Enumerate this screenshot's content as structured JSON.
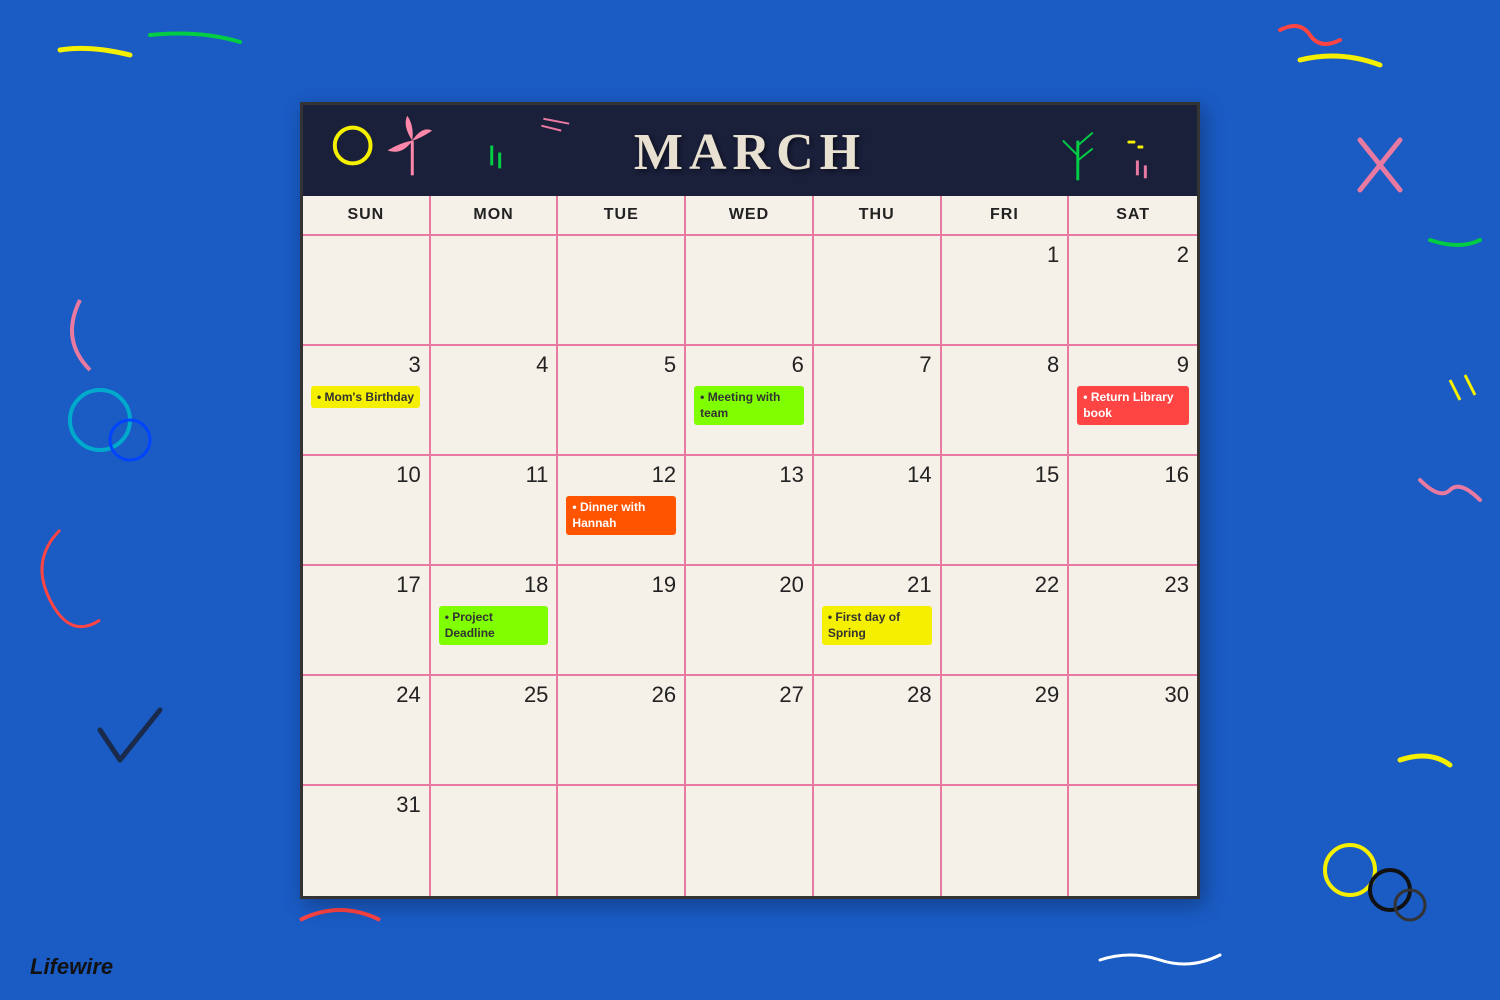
{
  "calendar": {
    "month": "MARCH",
    "day_names": [
      "SUN",
      "MON",
      "TUE",
      "WED",
      "THU",
      "FRI",
      "SAT"
    ],
    "cells": [
      {
        "day": "",
        "events": []
      },
      {
        "day": "",
        "events": []
      },
      {
        "day": "",
        "events": []
      },
      {
        "day": "",
        "events": []
      },
      {
        "day": "",
        "events": []
      },
      {
        "day": "1",
        "events": []
      },
      {
        "day": "2",
        "events": []
      },
      {
        "day": "3",
        "events": [
          {
            "label": "Mom's Birthday",
            "color": "event-yellow"
          }
        ]
      },
      {
        "day": "4",
        "events": []
      },
      {
        "day": "5",
        "events": []
      },
      {
        "day": "6",
        "events": [
          {
            "label": "Meeting with team",
            "color": "event-green"
          }
        ]
      },
      {
        "day": "7",
        "events": []
      },
      {
        "day": "8",
        "events": []
      },
      {
        "day": "9",
        "events": [
          {
            "label": "Return Library book",
            "color": "event-red"
          }
        ]
      },
      {
        "day": "10",
        "events": []
      },
      {
        "day": "11",
        "events": []
      },
      {
        "day": "12",
        "events": [
          {
            "label": "Dinner with Hannah",
            "color": "event-orange"
          }
        ]
      },
      {
        "day": "13",
        "events": []
      },
      {
        "day": "14",
        "events": []
      },
      {
        "day": "15",
        "events": []
      },
      {
        "day": "16",
        "events": []
      },
      {
        "day": "17",
        "events": []
      },
      {
        "day": "18",
        "events": [
          {
            "label": "Project Deadline",
            "color": "event-green"
          }
        ]
      },
      {
        "day": "19",
        "events": []
      },
      {
        "day": "20",
        "events": []
      },
      {
        "day": "21",
        "events": [
          {
            "label": "First day of Spring",
            "color": "event-yellow"
          }
        ]
      },
      {
        "day": "22",
        "events": []
      },
      {
        "day": "23",
        "events": []
      },
      {
        "day": "24",
        "events": []
      },
      {
        "day": "25",
        "events": []
      },
      {
        "day": "26",
        "events": []
      },
      {
        "day": "27",
        "events": []
      },
      {
        "day": "28",
        "events": []
      },
      {
        "day": "29",
        "events": []
      },
      {
        "day": "30",
        "events": []
      },
      {
        "day": "31",
        "events": []
      },
      {
        "day": "",
        "events": []
      },
      {
        "day": "",
        "events": []
      },
      {
        "day": "",
        "events": []
      },
      {
        "day": "",
        "events": []
      },
      {
        "day": "",
        "events": []
      },
      {
        "day": "",
        "events": []
      }
    ]
  },
  "brand": "Lifewire"
}
